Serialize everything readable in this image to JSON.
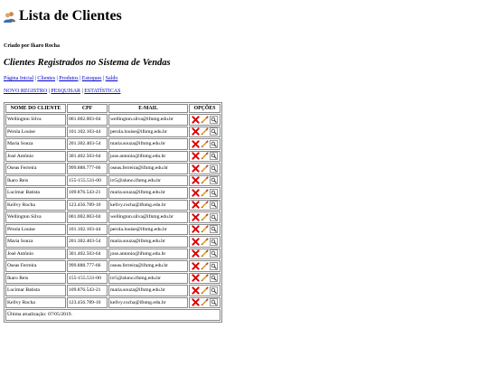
{
  "header": {
    "title": "Lista de Clientes",
    "logo_icon": "users-icon",
    "credit": "Criado por Ikaro Rocha",
    "subtitle": "Clientes Registrados no Sistema de Vendas"
  },
  "nav": {
    "items": [
      "Página Inicial",
      "Clientes",
      "Produtos",
      "Estoques",
      "Saldo"
    ],
    "separator": "|"
  },
  "actions": {
    "items": [
      "NOVO REGISTRO",
      "PESQUISAR",
      "ESTATÍSTICAS"
    ]
  },
  "table": {
    "headers": [
      "NOME DO CLIENTE",
      "CPF",
      "E-MAIL",
      "OPÇÕES"
    ],
    "rows": [
      [
        "Wellington Silva",
        "001.002.003-04",
        "wellington.silva@ifnmg.edu.br"
      ],
      [
        "Pérola Louise",
        "101.102.103-44",
        "perola.louise@ifnmg.edu.br"
      ],
      [
        "Maria Souza",
        "201.302.403-54",
        "maria.souza@ifnmg.edu.br"
      ],
      [
        "José Antônio",
        "301.402.503-64",
        "jose.antonio@ifnmg.edu.br"
      ],
      [
        "Oseas Ferreira",
        "999.888.777-66",
        "oseas.ferreira@ifnmg.edu.br"
      ],
      [
        "Ikaro Reis",
        "155-155.531-00",
        "irr5@aluno.ifnmg.edu.br"
      ],
      [
        "Lucimar Batista",
        "109.876.543-21",
        "maria.souza@ifnmg.edu.br"
      ],
      [
        "Kellvy Rocha",
        "123.456.789-10",
        "kellvy.rocha@ifnmg.edu.br"
      ],
      [
        "Wellington Silva",
        "001.002.003-04",
        "wellington.silva@ifnmg.edu.br"
      ],
      [
        "Pérola Louise",
        "101.102.103-44",
        "perola.louise@ifnmg.edu.br"
      ],
      [
        "Maria Souza",
        "201.302.403-54",
        "maria.souza@ifnmg.edu.br"
      ],
      [
        "José Antônio",
        "301.402.503-64",
        "jose.antonio@ifnmg.edu.br"
      ],
      [
        "Oseas Ferreira",
        "999.888.777-66",
        "oseas.ferreira@ifnmg.edu.br"
      ],
      [
        "Ikaro Reis",
        "155-155.531-00",
        "irr5@aluno.ifnmg.edu.br"
      ],
      [
        "Lucimar Batista",
        "109.876.543-21",
        "maria.souza@ifnmg.edu.br"
      ],
      [
        "Kellvy Rocha",
        "123.456.789-10",
        "kellvy.rocha@ifnmg.edu.br"
      ]
    ],
    "row_options": [
      "delete-icon",
      "edit-icon",
      "view-icon"
    ],
    "footer": "Última atualização: 07/05/2019."
  },
  "colors": {
    "link": "#0000cc",
    "delete": "#dd0000",
    "edit": "#e8a020",
    "border": "#888888"
  }
}
